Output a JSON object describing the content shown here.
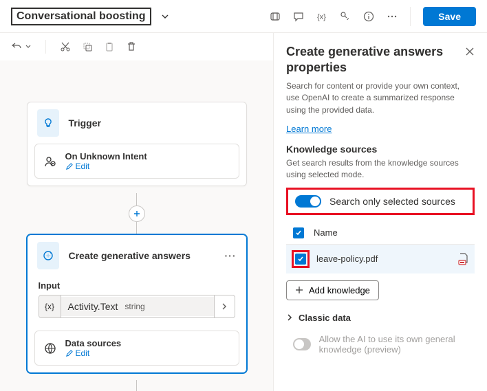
{
  "topbar": {
    "title": "Conversational boosting",
    "save": "Save"
  },
  "canvas": {
    "trigger": {
      "title": "Trigger",
      "inner_title": "On Unknown Intent",
      "edit": "Edit"
    },
    "gen": {
      "title": "Create generative answers",
      "input_label": "Input",
      "input_var": "Activity.Text",
      "input_type": "string",
      "data_sources": "Data sources",
      "edit": "Edit"
    }
  },
  "panel": {
    "title": "Create generative answers properties",
    "desc": "Search for content or provide your own context, use OpenAI to create a summarized response using the provided data.",
    "learn": "Learn more",
    "ks_title": "Knowledge sources",
    "ks_sub": "Get search results from the knowledge sources using selected mode.",
    "toggle_label": "Search only selected sources",
    "col_name": "Name",
    "file": "leave-policy.pdf",
    "add": "Add knowledge",
    "classic": "Classic data",
    "allow_ai": "Allow the AI to use its own general knowledge (preview)"
  }
}
